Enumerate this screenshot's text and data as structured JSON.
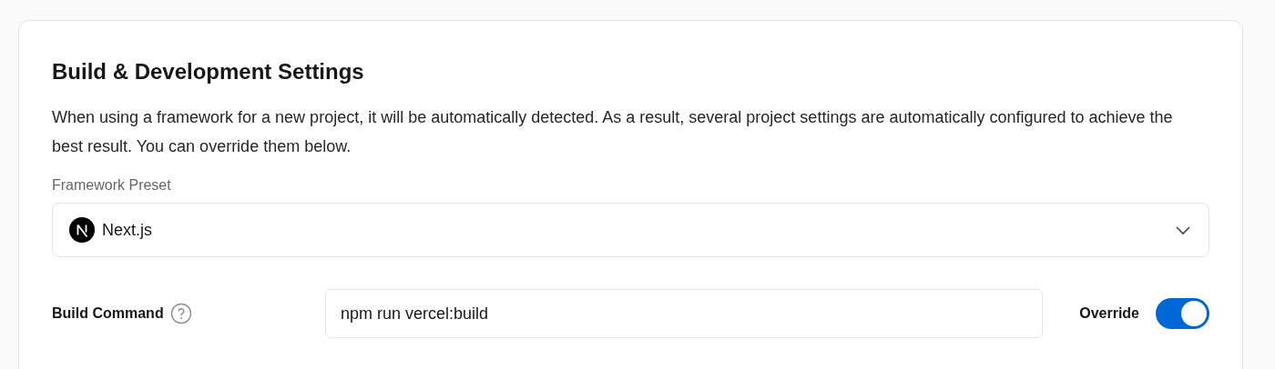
{
  "card": {
    "title": "Build & Development Settings",
    "description": "When using a framework for a new project, it will be automatically detected. As a result, several project settings are automatically configured to achieve the best result. You can override them below.",
    "framework": {
      "label": "Framework Preset",
      "value": "Next.js"
    },
    "build_command": {
      "label": "Build Command",
      "value": "npm run vercel:build",
      "override": {
        "label": "Override",
        "on": true
      }
    }
  }
}
